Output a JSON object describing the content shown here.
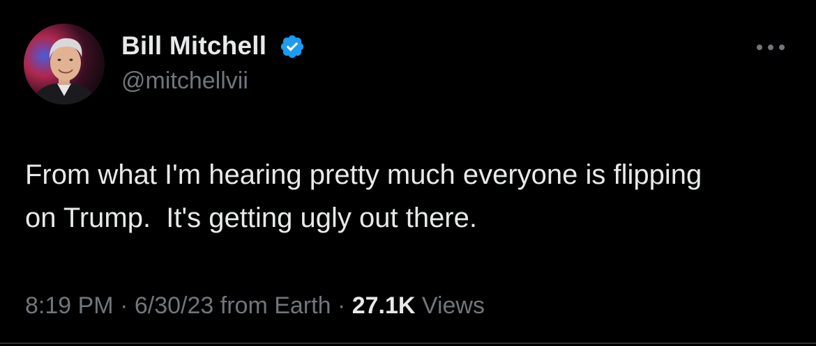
{
  "author": {
    "name": "Bill Mitchell",
    "handle": "@mitchellvii",
    "verified": true,
    "badge_color": "#1d9bf0"
  },
  "tweet": {
    "text": "From what I'm hearing pretty much everyone is flipping\non Trump.  It's getting ugly out there."
  },
  "meta": {
    "time": "8:19 PM",
    "separator": "·",
    "date": "6/30/23",
    "source": "from Earth",
    "views_count": "27.1K",
    "views_label": "Views"
  },
  "icons": {
    "more": "more-horizontal-icon",
    "verified": "verified-badge-icon"
  },
  "colors": {
    "background": "#000000",
    "primary_text": "#e7e9ea",
    "secondary_text": "#71767b",
    "accent": "#1d9bf0"
  }
}
